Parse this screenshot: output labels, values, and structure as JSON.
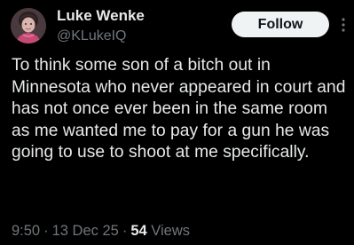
{
  "author": {
    "display_name": "Luke Wenke",
    "handle": "@KLukeIQ",
    "avatar_icon": "profile-photo"
  },
  "actions": {
    "follow_label": "Follow",
    "more_icon": "more-vertical-icon"
  },
  "tweet": {
    "text": "To think some son of a bitch out in Minnesota who never appeared in court and has not once ever been in the same room as me wanted me to pay for a gun he was going to use to shoot at me specifically."
  },
  "meta": {
    "time": "9:50",
    "date": "13 Dec 25",
    "separator": "·",
    "views_count": "54",
    "views_label": "Views"
  },
  "colors": {
    "background": "#000000",
    "primary_text": "#e7e9ea",
    "secondary_text": "#71767b",
    "button_bg": "#eff3f4"
  }
}
